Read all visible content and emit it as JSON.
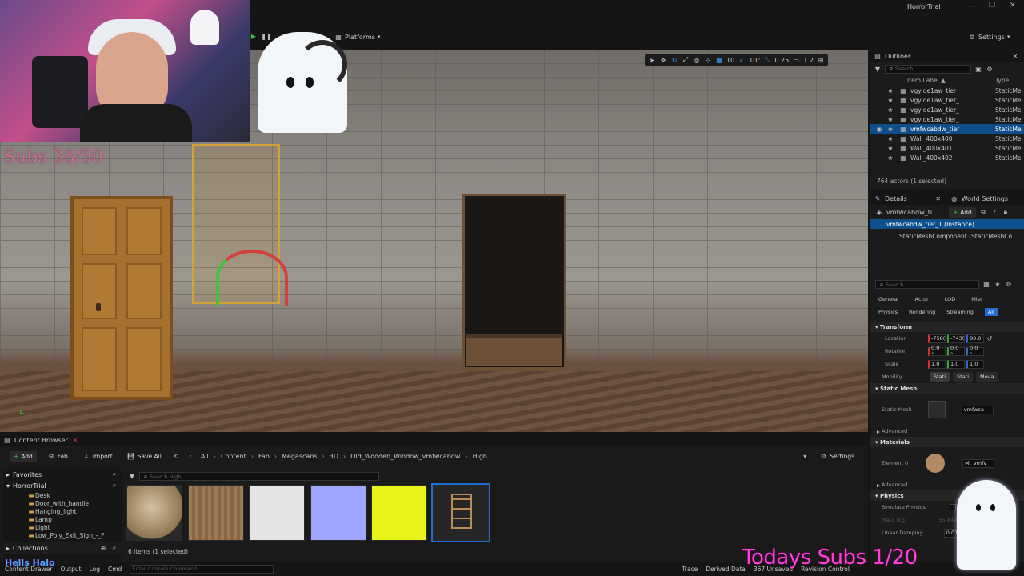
{
  "app": {
    "title": "HorrorTrial",
    "platforms": "Platforms",
    "settings": "Settings"
  },
  "viewport": {
    "snap_grid": "10",
    "snap_rot": "10°",
    "snap_scale": "0.25",
    "cam_speed": "1 2"
  },
  "outliner": {
    "tab": "Outliner",
    "search_placeholder": "Search",
    "col_label": "Item Label ▲",
    "col_type": "Type",
    "rows": [
      {
        "label": "vgyide1aw_tier_",
        "type": "StaticMe"
      },
      {
        "label": "vgyide1aw_tier_",
        "type": "StaticMe"
      },
      {
        "label": "vgyide1aw_tier_",
        "type": "StaticMe"
      },
      {
        "label": "vgyide1aw_tier_",
        "type": "StaticMe"
      },
      {
        "label": "vmfwcabdw_tier",
        "type": "StaticMe"
      },
      {
        "label": "Wall_400x400",
        "type": "StaticMe"
      },
      {
        "label": "Wall_400x401",
        "type": "StaticMe"
      },
      {
        "label": "Wall_400x402",
        "type": "StaticMe"
      }
    ],
    "status": "764 actors (1 selected)"
  },
  "details": {
    "tab": "Details",
    "world_tab": "World Settings",
    "actor": "vmfwcabdw_ti",
    "add": "Add",
    "instance": "vmfwcabdw_tier_1 (Instance)",
    "component": "StaticMeshComponent (StaticMeshCo",
    "search_placeholder": "Search",
    "filters1": [
      "General",
      "Actor",
      "LOD",
      "Misc"
    ],
    "filters2": [
      "Physics",
      "Rendering",
      "Streaming",
      "All"
    ],
    "transform": "Transform",
    "location_label": "Location",
    "location": [
      "-758(",
      "-743(",
      "80.0"
    ],
    "rotation_label": "Rotation",
    "rotation": [
      "0.0 °",
      "0.0 °",
      "0.0 °"
    ],
    "scale_label": "Scale",
    "scale": [
      "1.0",
      "1.0",
      "1.0"
    ],
    "mobility_label": "Mobility",
    "mobility": [
      "Stati",
      "Stati",
      "Mova"
    ],
    "static_mesh_section": "Static Mesh",
    "static_mesh_label": "Static Mesh",
    "static_mesh_value": "vmfwca",
    "advanced": "Advanced",
    "materials": "Materials",
    "element0": "Element 0",
    "element0_value": "MI_vmfv",
    "advanced2": "Advanced",
    "physics": "Physics",
    "simulate_physics": "Simulate Physics",
    "mass": "Mass (kg)",
    "mass_value": "55.8400",
    "linear_damping": "Linear Damping",
    "linear_damping_value": "0.01"
  },
  "content_browser": {
    "tab": "Content Browser",
    "add": "Add",
    "fab": "Fab",
    "import": "Import",
    "save_all": "Save All",
    "breadcrumb": [
      "All",
      "Content",
      "Fab",
      "Megascans",
      "3D",
      "Old_Wooden_Window_vmfwcabdw",
      "High"
    ],
    "settings": "Settings",
    "favorites": "Favorites",
    "project": "HorrorTrial",
    "folders": [
      "Desk",
      "Door_with_handle",
      "Hanging_light",
      "Lamp",
      "Light",
      "Low_Poly_Exit_Sign_-_F"
    ],
    "collections": "Collections",
    "search_placeholder": "Search High",
    "status": "6 items (1 selected)"
  },
  "statusbar": {
    "drawer": "Content Drawer",
    "output": "Output",
    "log": "Log",
    "cmd": "Cmd",
    "console_placeholder": "Enter Console Command",
    "trace": "Trace",
    "derived": "Derived Data",
    "unsaved": "367 Unsaved",
    "revision": "Revision Control"
  },
  "overlay": {
    "subs_goal": "Subs 38/50",
    "today": "Todays Subs 1/20",
    "watermark": "Hells Halo"
  }
}
